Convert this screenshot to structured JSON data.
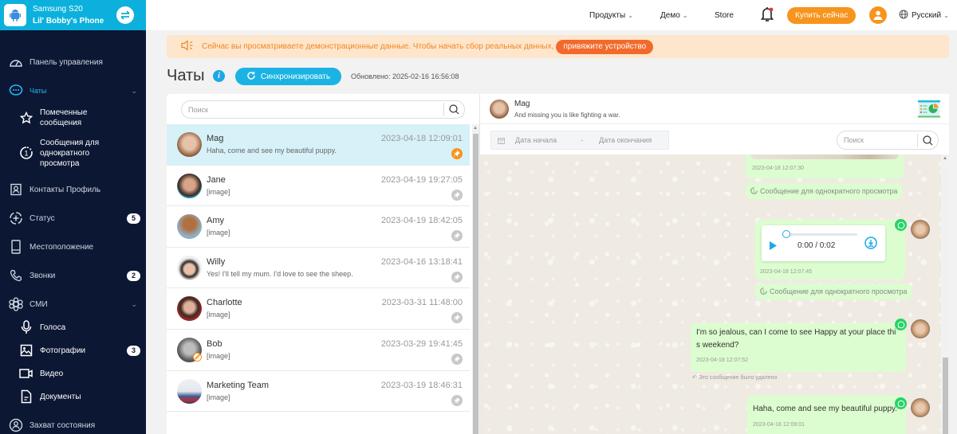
{
  "device": {
    "model": "Samsung S20",
    "name": "Lil' Bobby's Phone"
  },
  "sidebar": {
    "items": [
      {
        "label": "Панель управления",
        "icon": "dashboard-icon"
      },
      {
        "label": "Чаты",
        "icon": "chat-icon",
        "active": true,
        "expandable": true
      },
      {
        "label": "Помеченные сообщения",
        "icon": "star-icon",
        "sub": true
      },
      {
        "label": "Сообщения для однократного просмотра",
        "icon": "view-once-icon",
        "sub": true
      },
      {
        "label": "Контакты Профиль",
        "icon": "contacts-icon"
      },
      {
        "label": "Статус",
        "icon": "status-icon",
        "badge": "5"
      },
      {
        "label": "Местоположение",
        "icon": "location-icon"
      },
      {
        "label": "Звонки",
        "icon": "phone-icon",
        "badge": "2"
      },
      {
        "label": "СМИ",
        "icon": "media-icon",
        "expandable": true
      },
      {
        "label": "Голоса",
        "icon": "microphone-icon",
        "sub": true
      },
      {
        "label": "Фотографии",
        "icon": "photo-icon",
        "sub": true,
        "badge": "3"
      },
      {
        "label": "Видео",
        "icon": "video-icon",
        "sub": true
      },
      {
        "label": "Документы",
        "icon": "document-icon",
        "sub": true
      },
      {
        "label": "Захват состояния",
        "icon": "capture-icon"
      }
    ]
  },
  "topbar": {
    "products": "Продукты",
    "demo": "Демо",
    "store": "Store",
    "buy_now": "Купить сейчас",
    "language": "Русский"
  },
  "banner": {
    "text": "Сейчас вы просматриваете демонстрационные данные. Чтобы начать сбор реальных данных,",
    "button": "привяжите устройство"
  },
  "page": {
    "title": "Чаты",
    "info": "i",
    "sync_button": "Синхронизировать",
    "updated": "Обновлено: 2025-02-16 16:56:08"
  },
  "chat_list": {
    "search_placeholder": "Поиск",
    "chats": [
      {
        "name": "Mag",
        "preview": "Haha, come and see my beautiful puppy.",
        "time": "2023-04-18 12:09:01",
        "selected": true,
        "avatar_color": "#b5876a"
      },
      {
        "name": "Jane",
        "preview": "[image]",
        "time": "2023-04-19 19:27:05",
        "avatar_color": "#6b4a3a"
      },
      {
        "name": "Amy",
        "preview": "[image]",
        "time": "2023-04-19 18:42:05",
        "avatar_color": "#4f8fbf"
      },
      {
        "name": "Willy",
        "preview": "Yes! I'll tell my mum. I'd love to see the sheep.",
        "time": "2023-04-16 13:18:41",
        "avatar_color": "#e8e2dc"
      },
      {
        "name": "Charlotte",
        "preview": "[image]",
        "time": "2023-03-31 11:48:00",
        "avatar_color": "#8e3b35"
      },
      {
        "name": "Bob",
        "preview": "[image]",
        "time": "2023-03-29 19:41:45",
        "blocked": true,
        "avatar_color": "#8a8a8a"
      },
      {
        "name": "Marketing Team",
        "preview": "[image]",
        "time": "2023-03-19 18:46:31",
        "avatar_color": "#7b92b8"
      }
    ]
  },
  "conversation": {
    "contact": "Mag",
    "status": "And missing you is like fighting a war.",
    "date_start_placeholder": "Дата начала",
    "date_separator": "-",
    "date_end_placeholder": "Дата окончания",
    "search_placeholder": "Поиск",
    "messages": [
      {
        "type": "image",
        "time": "2023-04-18 12:07:30"
      },
      {
        "type": "view-once-note",
        "text": "Сообщение для однократного просмотра"
      },
      {
        "type": "audio",
        "position": "0:00 / 0:02",
        "progress": 0,
        "time": "2023-04-18 12:07:45"
      },
      {
        "type": "view-once-note",
        "text": "Сообщение для однократного просмотра"
      },
      {
        "type": "text",
        "text": "I'm so jealous, can I come to see Happy at your place thi s weekend?",
        "time": "2023-04-18 12:07:52",
        "deleted_note": "Это сообщение было удалено"
      },
      {
        "type": "text",
        "text": "Haha, come and see my beautiful puppy.",
        "time": "2023-04-18 12:09:01"
      }
    ]
  },
  "colors": {
    "accent": "#1bb3e3",
    "orange": "#f7941d",
    "sidebar": "#0c1733",
    "bubble": "#dcfdd0",
    "whatsapp": "#25d366"
  }
}
